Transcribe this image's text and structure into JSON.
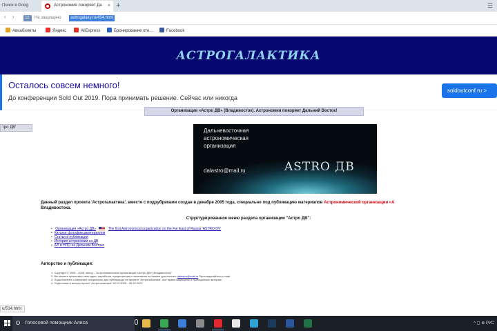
{
  "browser": {
    "tabs": [
      {
        "title": "Поиск в Goog",
        "active": false
      },
      {
        "title": "Астрономия покоряет Да",
        "active": true
      }
    ],
    "new_tab_label": "+",
    "window_controls": "☰",
    "ssl_badge": "12:",
    "not_secure_label": "Не защищено",
    "url": "astrogalaxy.ru/454.html",
    "bookmarks": [
      {
        "label": "Авиабилеты",
        "color": "#e8a11c"
      },
      {
        "label": "Яндекс",
        "color": "#e5322d"
      },
      {
        "label": "AliExpress",
        "color": "#e43225"
      },
      {
        "label": "Бронирование оте...",
        "color": "#2364c4"
      },
      {
        "label": "Facebook",
        "color": "#3b5998"
      }
    ]
  },
  "site": {
    "title": "АСТРОГАЛАКТИКА",
    "header_color": "#070770"
  },
  "ad": {
    "title": "Осталось совсем немного!",
    "text": "До конференции Sold Out 2019. Пора принимать решение. Сейчас или никогда",
    "button": "soldoutconf.ru  >"
  },
  "org_bar": "Организация «Астро ДВ» (Владивосток). Астрономия покоряет Дальний Восток!",
  "sidebar": {
    "link": "тро ДВ'"
  },
  "banner": {
    "lines": [
      "Дальневосточная",
      "астрономическая",
      "организация"
    ],
    "email": "dalastro@mail.ru",
    "logo": "ASTRO ДВ"
  },
  "intro": {
    "part1": "Данный раздел проекта 'Астрогалактика', вместе с подрубриками создан в декабре 2005 года, специально под публикацию материалов ",
    "red": "Астрономической организации «А",
    "part2": "Владивостока."
  },
  "menu": {
    "heading": "Структурированное меню раздела организации \"Астро ДВ\":",
    "items": [
      {
        "label": "Организация «Астро ДВ»",
        "extra": "The first Astronomical organization on the Far East of Russia 'ASTRO DV'"
      },
      {
        "label": "Каталог фотофиксаматериалов"
      },
      {
        "label": "Статьи и публикации"
      },
      {
        "label": "История астрономии на ДВ"
      },
      {
        "label": "АЛ и НПО на Дальнем Востоке"
      }
    ]
  },
  "authorship": {
    "heading": "Авторство и публикация:",
    "lines": [
      "1. Copyright © 2005 - 2006, автор - \"Астрономическая организация «Астро ДВ» (Владивосток)\"",
      "2. Вы можете присылать свои идеи, наработки, предложения и пожелания на пишем для письма: ",
      "3. Подготовлено и написано специально для публикации на проекте 'Астрогалактика', все права защищены и принадлежат авторам.",
      "4. Подготовка и выпуск проект 'Астрогалактика' 18.12.2005 - 06.10.2007"
    ],
    "email": "dalastro@mail.ru",
    "after_email": " Присоединяйтесь к нам!"
  },
  "status_url": "u/514.html",
  "taskbar": {
    "search_text": "Голосовой помощник Алиса",
    "apps": [
      {
        "name": "folder-app-icon",
        "color": "#e8b84a",
        "active": false
      },
      {
        "name": "chrome-app-icon",
        "color": "#3aa757",
        "active": true
      },
      {
        "name": "store-app-icon",
        "color": "#3d7edb",
        "active": false
      },
      {
        "name": "apps-grid-icon",
        "color": "#8a8a8a",
        "active": false
      },
      {
        "name": "opera-app-icon",
        "color": "#e0282e",
        "active": true
      },
      {
        "name": "yandex-browser-icon",
        "color": "#e8e8e8",
        "active": false
      },
      {
        "name": "telegram-app-icon",
        "color": "#2fa3d9",
        "active": false
      },
      {
        "name": "photoshop-app-icon",
        "color": "#1b3a5c",
        "active": false
      },
      {
        "name": "word-app-icon",
        "color": "#2b579a",
        "active": false
      },
      {
        "name": "excel-app-icon",
        "color": "#217346",
        "active": false
      }
    ],
    "tray": "^ ◻ ⊗ РУС"
  }
}
